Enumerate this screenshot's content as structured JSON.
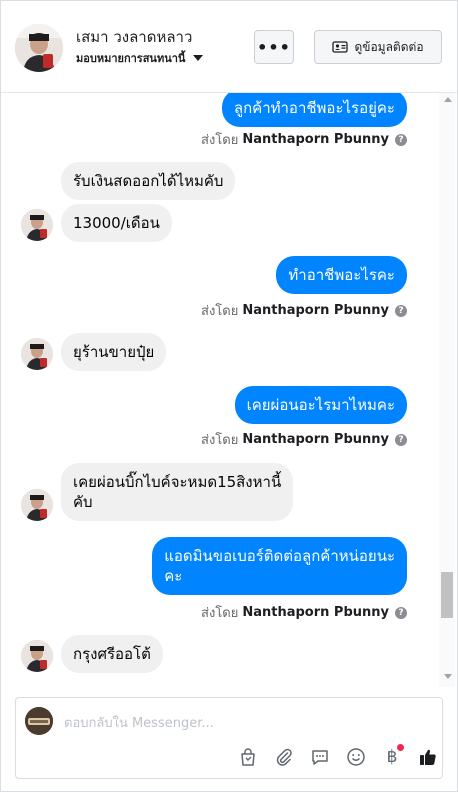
{
  "header": {
    "contact_name": "เสมา วงลาดหลาว",
    "assign_label": "มอบหมายการสนทนานี้",
    "more_label": "•••",
    "contact_info_label": "ดูข้อมูลติดต่อ"
  },
  "messages": {
    "m1": "ลูกค้าทำอาชีพอะไรอยู่คะ",
    "m2": "รับเงินสดออกได้ไหมคับ",
    "m3": "13000/เดือน",
    "m4": "ทำอาชีพอะไรคะ",
    "m5": "ยุร้านขายปุ๋ย",
    "m6": "เคยผ่อนอะไรมาไหมคะ",
    "m7_line1": "เคยผ่อนบิ๊กไบค์จะหมด15สิงหานี้",
    "m7_line2": "คับ",
    "m8_line1": "แอดมินขอเบอร์ติดต่อลูกค้าหน่อยนะ",
    "m8_line2": "คะ",
    "m9": "กรุงศรีออโต้"
  },
  "sent_by": {
    "prefix": "ส่งโดย",
    "agent": "Nanthaporn Pbunny",
    "help_icon": "?"
  },
  "composer": {
    "placeholder": "ตอบกลับใน Messenger...",
    "baht_symbol": "฿"
  },
  "colors": {
    "outgoing_bubble": "#0084ff",
    "incoming_bubble": "#f0f0f0",
    "like_icon": "#1c1e21",
    "notification_dot": "#f02849"
  }
}
